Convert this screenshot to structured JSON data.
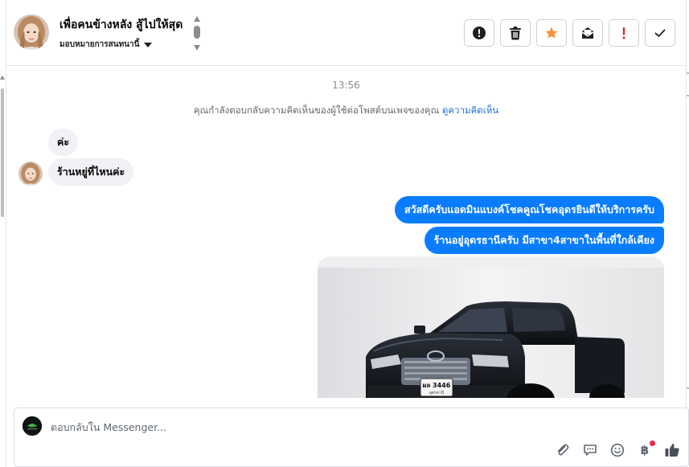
{
  "header": {
    "contact_name": "เพื่อคนข้างหลัง สู้ไปให้สุด",
    "assign_label": "มอบหมายการสนทนานี้"
  },
  "actions": [
    {
      "icon": "exclamation-circle-icon"
    },
    {
      "icon": "trash-icon"
    },
    {
      "icon": "star-icon"
    },
    {
      "icon": "mark-unread-icon"
    },
    {
      "icon": "spam-exclamation-icon"
    },
    {
      "icon": "check-done-icon"
    }
  ],
  "conversation": {
    "timestamp": "13:56",
    "notice_text": "คุณกำลังตอบกลับความคิดเห็นของผู้ใช้ต่อโพสต์บนเพจของคุณ",
    "notice_link": "ดูความคิดเห็น",
    "incoming": [
      {
        "text": "ค่ะ"
      },
      {
        "text": "ร้านหยู่ที่ไหนค่ะ"
      }
    ],
    "outgoing": [
      {
        "text": "สวัสดีครับแอดมินแบงค์โชคคูณโชคอุดรยินดีให้บริการครับ"
      },
      {
        "text": "ร้านอยู่อุดรธานีครับ มีสาขา4สาขาในพื้นที่ใกล้เคียง"
      }
    ],
    "photo": {
      "plate_text": "ผล 3446",
      "plate_sub": "อุดรธานี"
    }
  },
  "composer": {
    "placeholder": "ตอบกลับใน Messenger...",
    "tools": [
      "attach-icon",
      "saved-replies-icon",
      "emoji-icon",
      "payment-baht-icon",
      "like-thumb-icon"
    ],
    "baht_symbol": "฿"
  },
  "colors": {
    "outgoing_bubble": "#0a7cff",
    "incoming_bubble": "#f0f2f5",
    "star": "#f7923b",
    "spam": "#e02424",
    "link": "#216fdb",
    "notification_dot": "#f02849"
  }
}
